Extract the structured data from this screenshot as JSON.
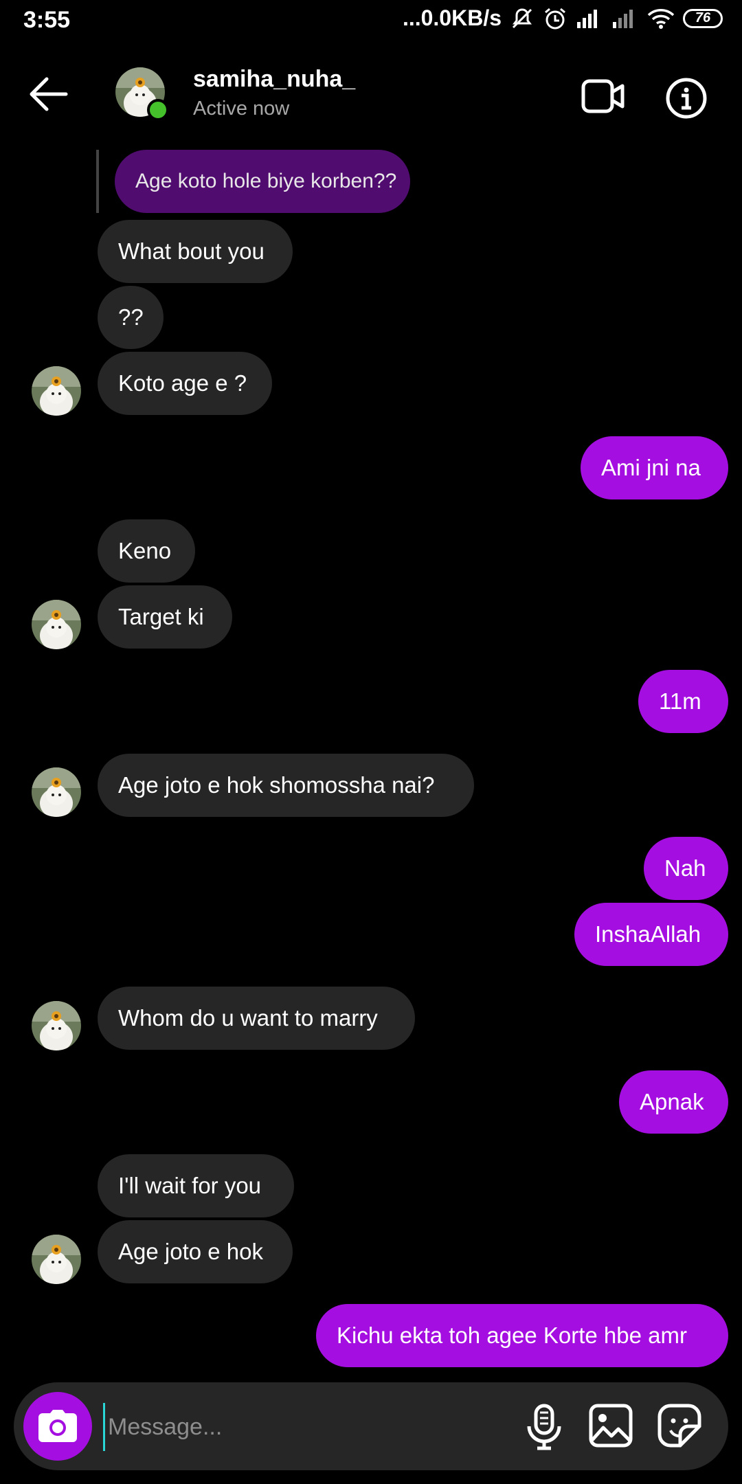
{
  "status_bar": {
    "time": "3:55",
    "network_speed": "...0.0KB/s",
    "battery": "76",
    "icons": [
      "mute-icon",
      "alarm-icon",
      "signal-icon",
      "signal-icon-2",
      "wifi-icon",
      "battery-icon"
    ]
  },
  "header": {
    "username": "samiha_nuha_",
    "status": "Active now",
    "icons": [
      "back-arrow-icon",
      "video-call-icon",
      "info-icon"
    ]
  },
  "messages": [
    {
      "side": "quote",
      "text": "Age koto hole biye korben??"
    },
    {
      "side": "in",
      "text": "What bout you"
    },
    {
      "side": "in",
      "text": "??"
    },
    {
      "side": "in",
      "text": "Koto age e ?"
    },
    {
      "side": "out",
      "text": "Ami jni na"
    },
    {
      "side": "in",
      "text": "Keno"
    },
    {
      "side": "in",
      "text": "Target ki"
    },
    {
      "side": "out",
      "text": "11m"
    },
    {
      "side": "in",
      "text": "Age joto e hok shomossha nai?"
    },
    {
      "side": "out",
      "text": "Nah"
    },
    {
      "side": "out",
      "text": "InshaAllah"
    },
    {
      "side": "in",
      "text": "Whom do u want to marry"
    },
    {
      "side": "out",
      "text": "Apnak"
    },
    {
      "side": "in",
      "text": "I'll wait for you"
    },
    {
      "side": "in",
      "text": "Age joto e hok"
    },
    {
      "side": "out",
      "text": "Kichu ekta toh agee Korte hbe amr"
    }
  ],
  "composer": {
    "placeholder": "Message...",
    "icons": [
      "camera-icon",
      "microphone-icon",
      "gallery-icon",
      "sticker-icon"
    ]
  },
  "colors": {
    "background": "#000000",
    "incoming_bubble": "#262626",
    "outgoing_bubble": "#a40ee0",
    "quoted_bubble": "#510c70",
    "online": "#44c12b",
    "secondary_text": "#a8a8a8"
  }
}
